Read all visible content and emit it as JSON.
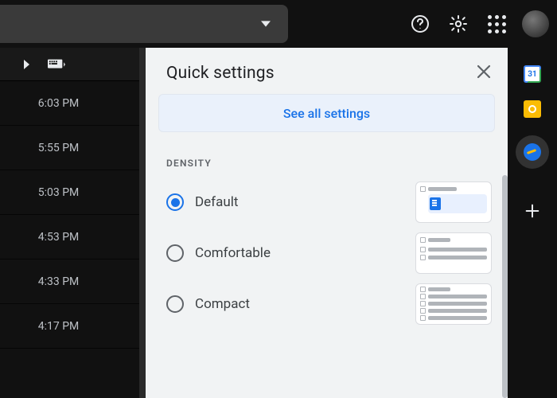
{
  "header": {
    "icons": {
      "help": "help-icon",
      "settings": "gear-icon",
      "apps": "apps-grid-icon",
      "avatar": "user-avatar"
    }
  },
  "inbox": {
    "times": [
      "6:03 PM",
      "5:55 PM",
      "5:03 PM",
      "4:53 PM",
      "4:33 PM",
      "4:17 PM"
    ]
  },
  "quick_settings": {
    "title": "Quick settings",
    "see_all_label": "See all settings",
    "density": {
      "section_label": "DENSITY",
      "options": [
        {
          "label": "Default",
          "selected": true
        },
        {
          "label": "Comfortable",
          "selected": false
        },
        {
          "label": "Compact",
          "selected": false
        }
      ]
    }
  },
  "side_apps": [
    "calendar",
    "keep",
    "tasks",
    "add"
  ]
}
